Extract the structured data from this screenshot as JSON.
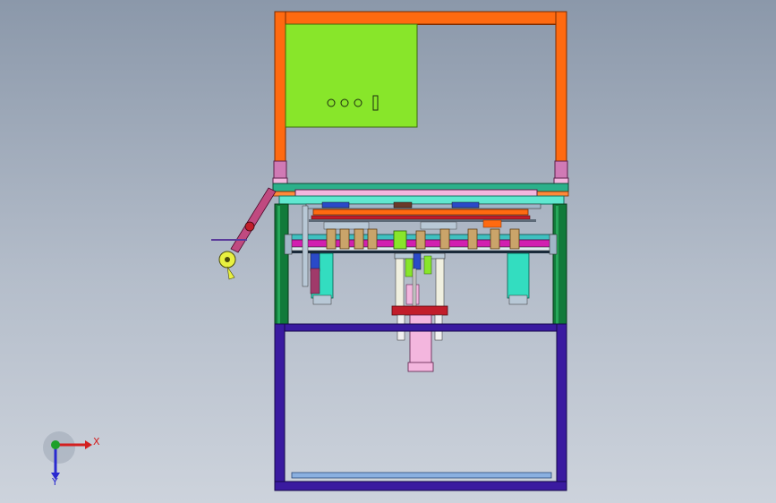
{
  "viewport": {
    "background_top": "#8b98aa",
    "background_bottom": "#cdd3dc"
  },
  "model": {
    "frame_orange": "#ff6a10",
    "panel_green": "#88e62a",
    "frame_blue": "#3a1aa0",
    "post_green": "#117a3a",
    "rail_magenta": "#d21fb0",
    "plate_pink": "#f3b6de",
    "cylinder_cyan": "#33ddc0",
    "accent_red": "#c11d2a"
  },
  "triad": {
    "x_label": "X",
    "y_label": "Y",
    "x_color": "#d31f1f",
    "y_color": "#2a2ad0",
    "z_color": "#1ea02a"
  }
}
